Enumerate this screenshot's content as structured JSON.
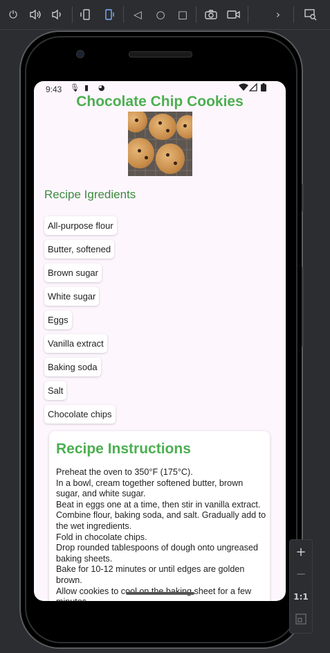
{
  "toolbar": {
    "icons": [
      "power-icon",
      "volume-up-icon",
      "volume-down-icon",
      "rotate-left-icon",
      "rotate-right-icon",
      "back-icon",
      "home-icon",
      "overview-icon",
      "camera-icon",
      "video-icon",
      "more-icon",
      "inspect-icon"
    ]
  },
  "status": {
    "time": "9:43"
  },
  "app": {
    "title": "Chocolate Chip Cookies",
    "ingredients_heading": "Recipe Igredients",
    "ingredients": [
      "All-purpose flour",
      "Butter, softened",
      "Brown sugar",
      "White sugar",
      "Eggs",
      "Vanilla extract",
      "Baking soda",
      "Salt",
      "Chocolate chips"
    ],
    "instructions_heading": "Recipe Instructions",
    "instructions": [
      "Preheat the oven to 350°F (175°C).",
      "In a bowl, cream together softened butter, brown sugar, and white sugar.",
      "Beat in eggs one at a time, then stir in vanilla extract.",
      "Combine flour, baking soda, and salt. Gradually add to the wet ingredients.",
      "Fold in chocolate chips.",
      "Drop rounded tablespoons of dough onto ungreased baking sheets.",
      "Bake for 10-12 minutes or until edges are golden brown.",
      "Allow cookies to cool on the baking sheet for a few minutes."
    ]
  },
  "zoom": {
    "plus": "+",
    "minus": "−",
    "ratio": "1:1"
  },
  "colors": {
    "accent": "#4caf50",
    "heading": "#3d8b40",
    "screen_bg": "#fdf6fd"
  }
}
